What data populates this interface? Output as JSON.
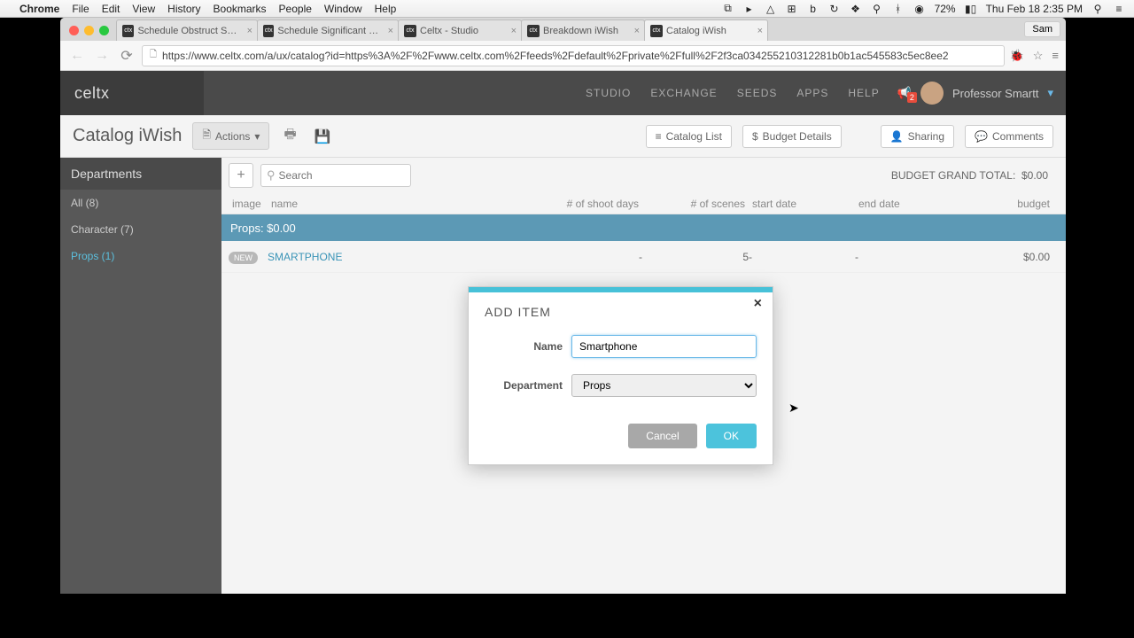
{
  "menubar": {
    "app": "Chrome",
    "menus": [
      "File",
      "Edit",
      "View",
      "History",
      "Bookmarks",
      "People",
      "Window",
      "Help"
    ],
    "battery": "72%",
    "clock": "Thu Feb 18  2:35 PM"
  },
  "tabs": [
    {
      "label": "Schedule Obstruct Sean"
    },
    {
      "label": "Schedule Significant Other"
    },
    {
      "label": "Celtx - Studio"
    },
    {
      "label": "Breakdown iWish"
    },
    {
      "label": "Catalog iWish"
    }
  ],
  "tab_user": "Sam",
  "url": "https://www.celtx.com/a/ux/catalog?id=https%3A%2F%2Fwww.celtx.com%2Ffeeds%2Fdefault%2Fprivate%2Ffull%2F2f3ca034255210312281b0b1ac545583c5ec8ee2",
  "brand": "celtx",
  "topnav": {
    "links": [
      "STUDIO",
      "EXCHANGE",
      "SEEDS",
      "APPS",
      "HELP"
    ],
    "badge": "2",
    "user": "Professor Smartt"
  },
  "subheader": {
    "title": "Catalog iWish",
    "actions": "Actions",
    "catalog_list": "Catalog List",
    "budget_details": "Budget Details",
    "sharing": "Sharing",
    "comments": "Comments"
  },
  "sidebar": {
    "title": "Departments",
    "items": [
      {
        "label": "All (8)"
      },
      {
        "label": "Character (7)"
      },
      {
        "label": "Props (1)",
        "active": true
      }
    ]
  },
  "toolbar": {
    "search_placeholder": "Search",
    "grand_label": "BUDGET GRAND TOTAL:",
    "grand_value": "$0.00"
  },
  "columns": {
    "image": "image",
    "name": "name",
    "shoot": "# of shoot days",
    "scenes": "# of scenes",
    "start": "start date",
    "end": "end date",
    "budget": "budget"
  },
  "group": {
    "label": "Props: $0.00"
  },
  "rows": [
    {
      "new": "NEW",
      "name": "SMARTPHONE",
      "shoot": "-",
      "scenes": "5",
      "start": "-",
      "end": "-",
      "budget": "$0.00"
    }
  ],
  "modal": {
    "title": "ADD ITEM",
    "name_label": "Name",
    "name_value": "Smartphone",
    "dept_label": "Department",
    "dept_value": "Props",
    "cancel": "Cancel",
    "ok": "OK"
  }
}
